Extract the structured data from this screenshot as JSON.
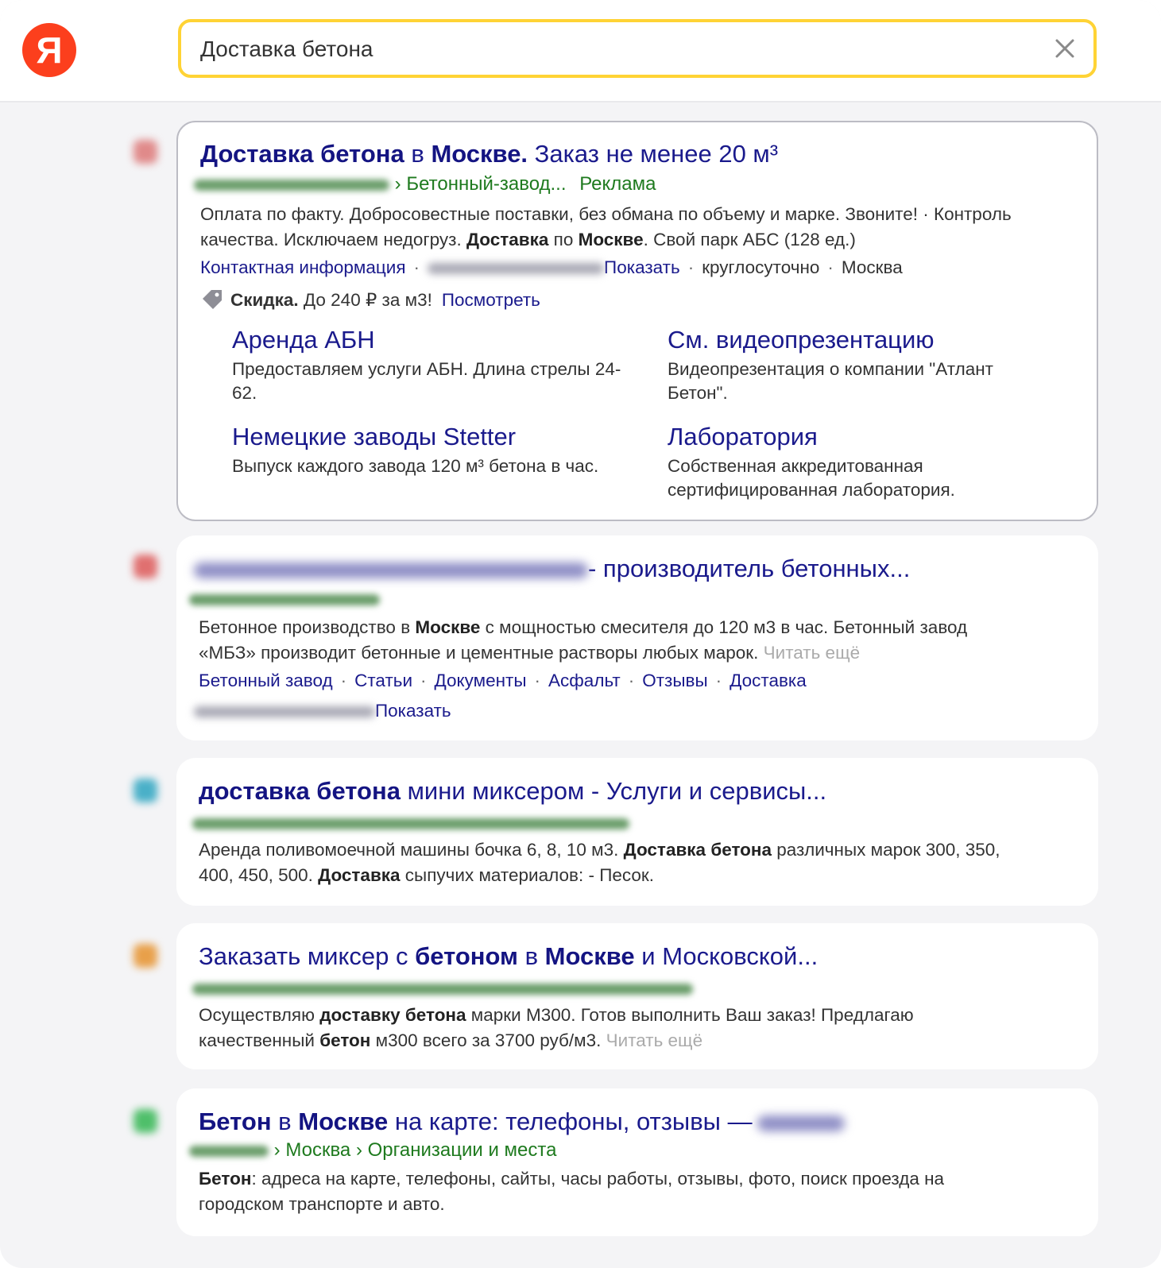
{
  "header": {
    "logo_letter": "Я",
    "search_value": "Доставка бетона"
  },
  "ad": {
    "title_b1": "Доставка бетона",
    "title_t1": " в ",
    "title_b2": "Москве.",
    "title_t2": " Заказ не менее 20 м³",
    "url_path": "› Бетонный-завод...",
    "ad_label": "Реклама",
    "desc_line1": "Оплата по факту. Добросовестные поставки, без обмана по объему и марке. Звоните! · Контроль",
    "desc_l2_a": "качества. Исключаем недогруз. ",
    "desc_l2_b": "Доставка",
    "desc_l2_c": " по ",
    "desc_l2_d": "Москве",
    "desc_l2_e": ". Свой парк АБС (128 ед.)",
    "contact_label": "Контактная информация",
    "show_label": "Показать",
    "hours": "круглосуточно",
    "city": "Москва",
    "promo_bold": "Скидка.",
    "promo_text": " До 240 ₽ за м3!",
    "promo_link": "Посмотреть",
    "sitelinks": [
      {
        "title": "Аренда АБН",
        "desc": "Предоставляем услуги АБН. Длина стрелы 24-62."
      },
      {
        "title": "См. видеопрезентацию",
        "desc": "Видеопрезентация о компании \"Атлант Бетон\"."
      },
      {
        "title": "Немецкие заводы Stetter",
        "desc": "Выпуск каждого завода 120 м³ бетона в час."
      },
      {
        "title": "Лаборатория",
        "desc": "Собственная аккредитованная сертифицированная лаборатория."
      }
    ]
  },
  "result2": {
    "title": "- производитель бетонных...",
    "desc_a": "Бетонное производство в ",
    "desc_b": "Москве",
    "desc_c": " с мощностью смесителя до 120 м3 в час. Бетонный завод",
    "desc_d": "«МБЗ» производит бетонные и цементные растворы любых марок. ",
    "read_more": "Читать ещё",
    "links": [
      "Бетонный завод",
      "Статьи",
      "Документы",
      "Асфальт",
      "Отзывы",
      "Доставка"
    ],
    "show_label": "Показать"
  },
  "result3": {
    "title_b": "доставка бетона",
    "title_t": " мини миксером - Услуги и сервисы...",
    "desc_a": "Аренда поливомоечной машины бочка 6, 8, 10 м3. ",
    "desc_b": "Доставка бетона",
    "desc_c": " различных марок 300, 350,",
    "desc_d": "400, 450, 500. ",
    "desc_e": "Доставка",
    "desc_f": " сыпучих материалов: - Песок."
  },
  "result4": {
    "title_t1": "Заказать миксер с ",
    "title_b1": "бетоном",
    "title_t2": " в ",
    "title_b2": "Москве",
    "title_t3": " и Московской...",
    "desc_a": "Осуществляю ",
    "desc_b": "доставку бетона",
    "desc_c": " марки М300. Готов выполнить Ваш заказ! Предлагаю",
    "desc_d": "качественный ",
    "desc_e": "бетон",
    "desc_f": " м300 всего за 3700 руб/м3. ",
    "read_more": "Читать ещё"
  },
  "result5": {
    "title_b1": "Бетон",
    "title_t1": " в ",
    "title_b2": "Москве",
    "title_t2": " на карте: телефоны, отзывы —",
    "crumb1": "› Москва",
    "crumb2": "› Организации и места",
    "desc_b": "Бетон",
    "desc_a": ": адреса на карте, телефоны, сайты, часы работы, отзывы, фото, поиск проезда на",
    "desc_c": "городском транспорте и авто."
  }
}
